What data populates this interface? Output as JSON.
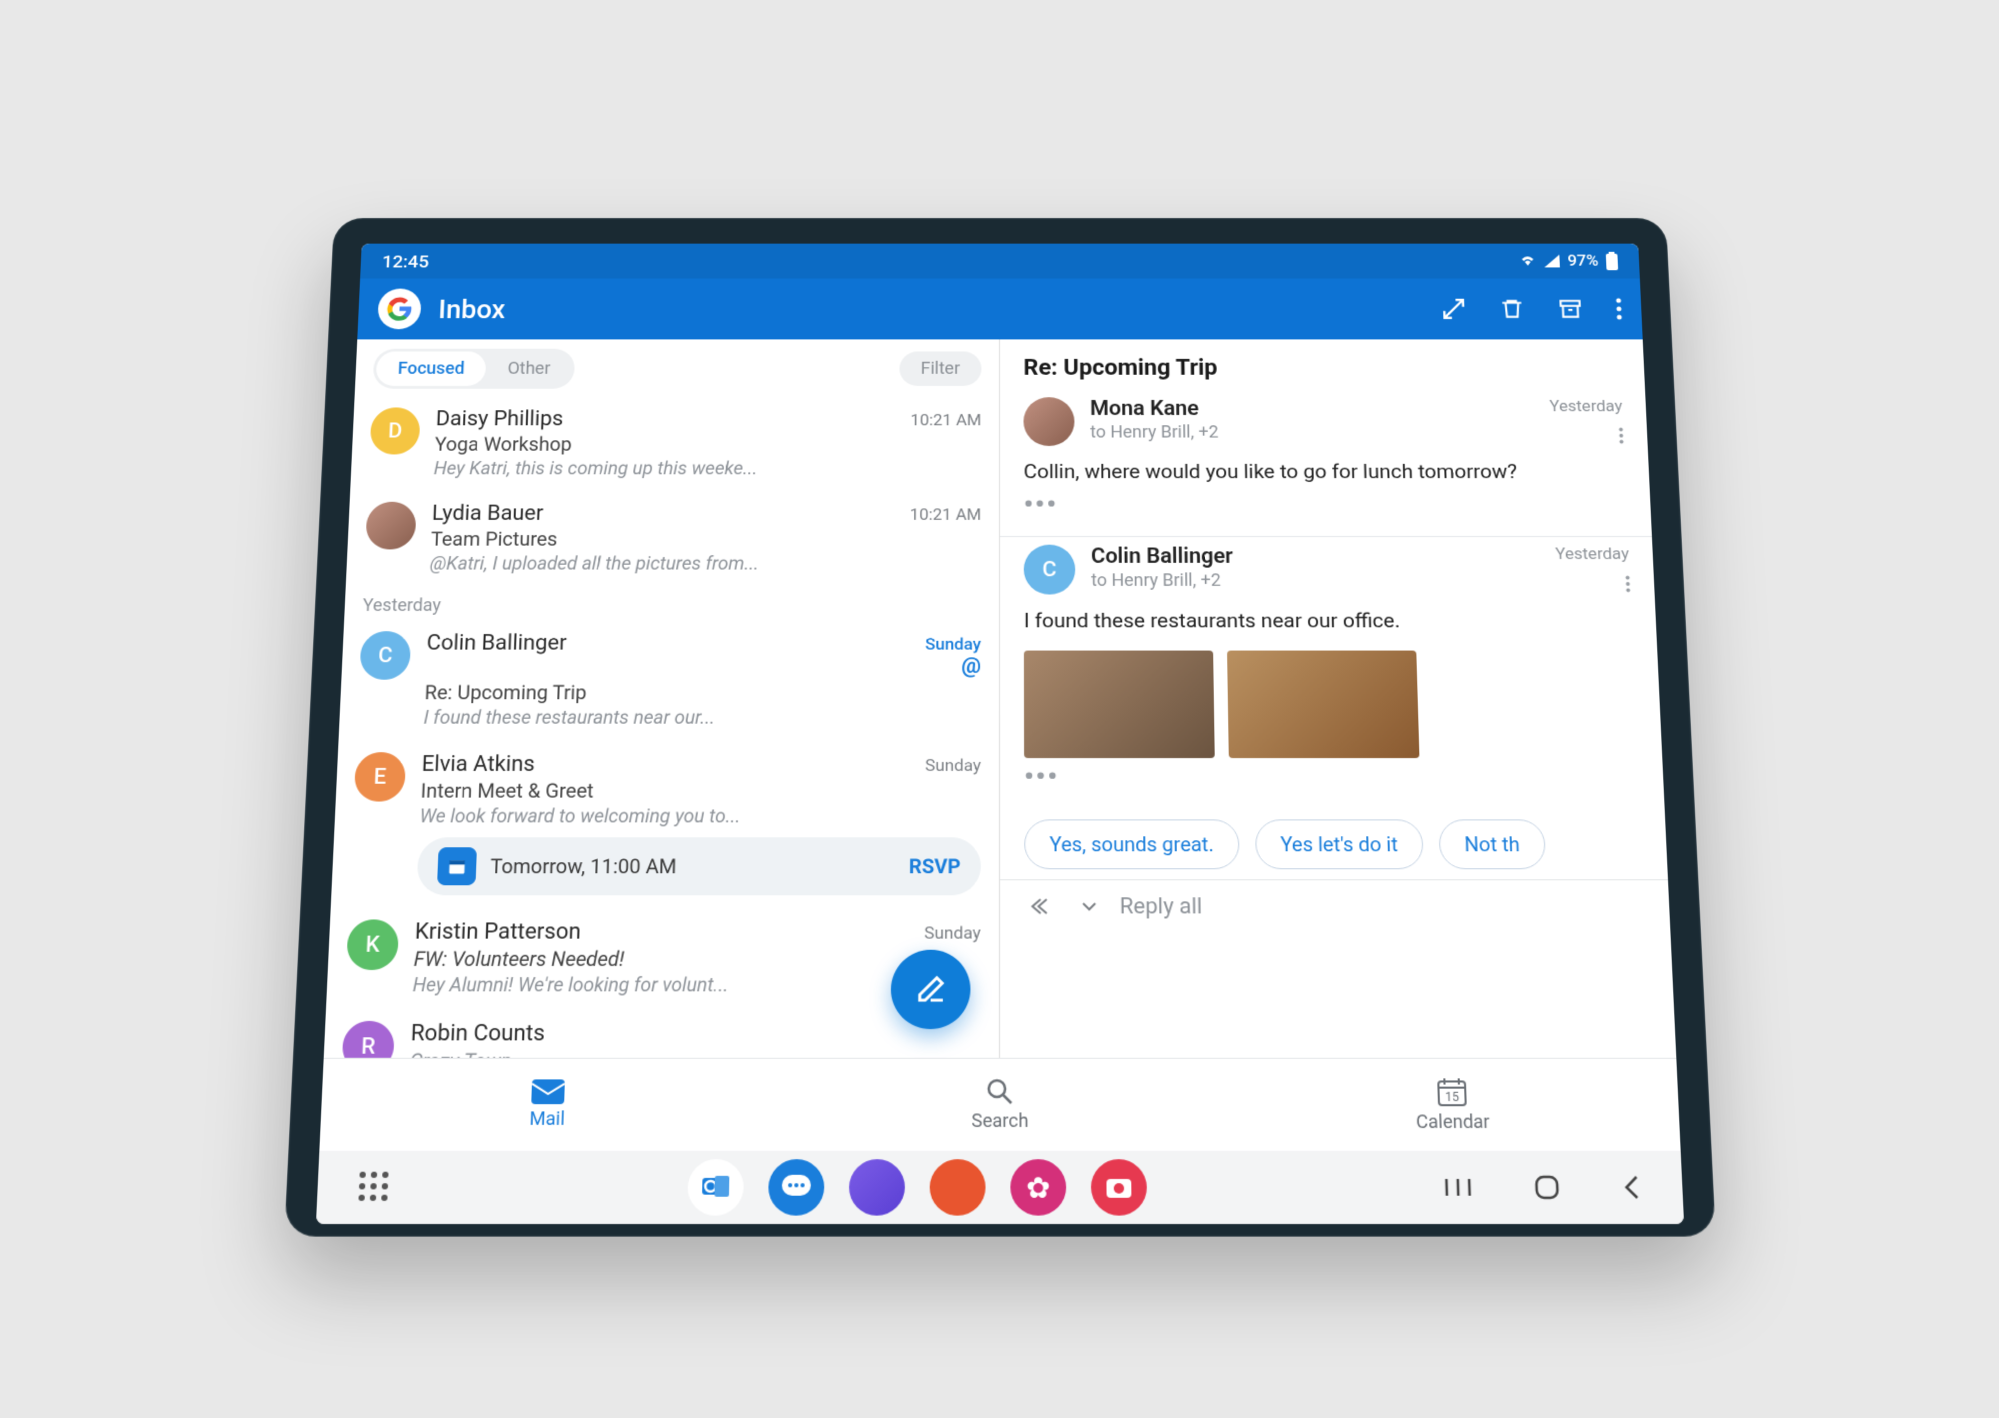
{
  "status": {
    "time": "12:45",
    "battery": "97%"
  },
  "header": {
    "title": "Inbox"
  },
  "tabs": {
    "focused": "Focused",
    "other": "Other",
    "filter": "Filter"
  },
  "icons": {
    "expand": "expand",
    "trash": "delete",
    "archive": "archive",
    "more": "more"
  },
  "date_headers": {
    "yesterday": "Yesterday"
  },
  "emails": [
    {
      "sender": "Daisy Phillips",
      "subject": "Yoga Workshop",
      "preview": "Hey Katri, this is coming up this weeke...",
      "time": "10:21 AM",
      "avatar_letter": "D",
      "avatar_color": "#f5c542"
    },
    {
      "sender": "Lydia Bauer",
      "subject": "Team Pictures",
      "preview": "@Katri, I uploaded all the pictures from...",
      "time": "10:21 AM",
      "avatar_photo": true
    },
    {
      "sender": "Colin Ballinger",
      "subject": "Re: Upcoming Trip",
      "preview": "I found these restaurants near our...",
      "time": "Sunday",
      "accent_time": true,
      "at_badge": "@",
      "avatar_letter": "C",
      "avatar_color": "#6ab7ea"
    },
    {
      "sender": "Elvia Atkins",
      "subject": "Intern Meet & Greet",
      "preview": "We look forward to welcoming you to...",
      "time": "Sunday",
      "avatar_letter": "E",
      "avatar_color": "#ed8c4a",
      "rsvp_time": "Tomorrow, 11:00 AM",
      "rsvp_label": "RSVP"
    },
    {
      "sender": "Kristin Patterson",
      "subject": "FW: Volunteers Needed!",
      "preview": "Hey Alumni! We're looking for volunt...",
      "time": "Sunday",
      "avatar_letter": "K",
      "avatar_color": "#5bbf68",
      "italic_subject": true
    },
    {
      "sender": "Robin Counts",
      "subject": "Crazy Town",
      "preview": "",
      "time": "",
      "avatar_letter": "R",
      "avatar_color": "#a666d4"
    }
  ],
  "reading": {
    "subject": "Re: Upcoming Trip",
    "messages": [
      {
        "sender": "Mona Kane",
        "recipients": "to Henry Brill, +2",
        "time": "Yesterday",
        "body": "Collin, where would  you like to go for lunch tomorrow?",
        "avatar_photo": true
      },
      {
        "sender": "Colin Ballinger",
        "recipients": "to Henry Brill, +2",
        "time": "Yesterday",
        "body": "I found these restaurants near our office.",
        "avatar_letter": "C",
        "avatar_color": "#6ab7ea",
        "has_images": true
      }
    ],
    "suggestions": [
      "Yes, sounds great.",
      "Yes let's do it",
      "Not th"
    ],
    "reply_label": "Reply all"
  },
  "bottom_tabs": {
    "mail": "Mail",
    "search": "Search",
    "calendar": "Calendar",
    "calendar_day": "15"
  }
}
